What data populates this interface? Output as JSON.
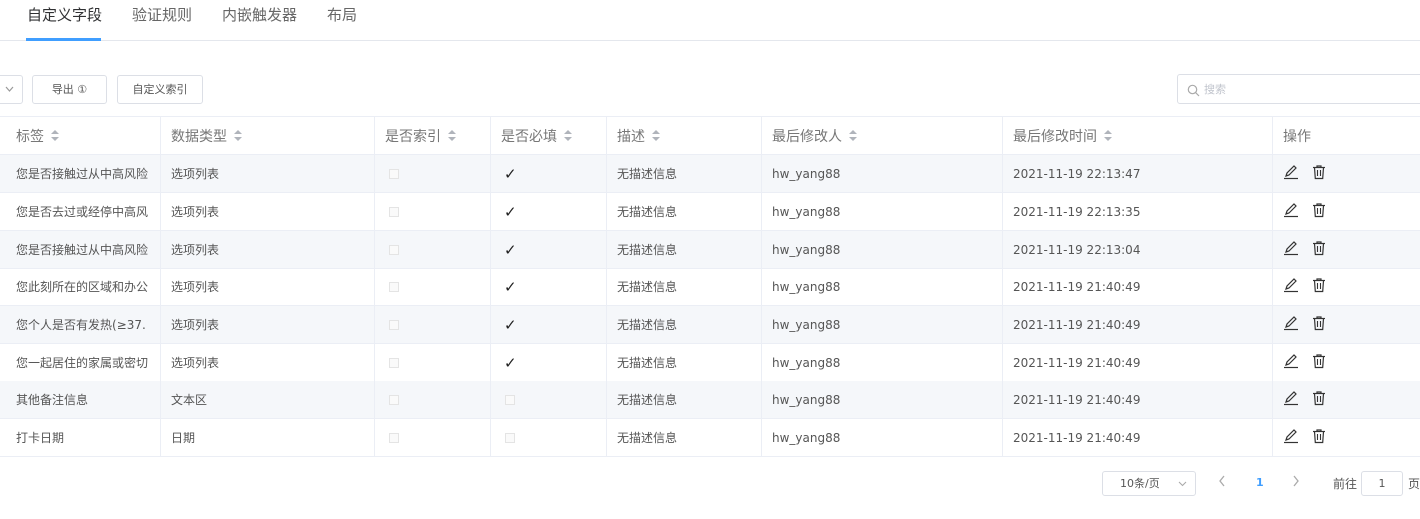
{
  "tabs": [
    {
      "label": "自定义字段",
      "active": true
    },
    {
      "label": "验证规则",
      "active": false
    },
    {
      "label": "内嵌触发器",
      "active": false
    },
    {
      "label": "布局",
      "active": false
    }
  ],
  "toolbar": {
    "export_label": "导出 ①",
    "custom_index_label": "自定义索引",
    "search_placeholder": "搜索",
    "search_value": ""
  },
  "table": {
    "columns": [
      "标签",
      "数据类型",
      "是否索引",
      "是否必填",
      "描述",
      "最后修改人",
      "最后修改时间",
      "操作"
    ],
    "rows": [
      {
        "label": "您是否接触过从中高风险",
        "type": "选项列表",
        "indexed": false,
        "required": true,
        "desc": "无描述信息",
        "modifier": "hw_yang88",
        "time": "2021-11-19 22:13:47"
      },
      {
        "label": "您是否去过或经停中高风",
        "type": "选项列表",
        "indexed": false,
        "required": true,
        "desc": "无描述信息",
        "modifier": "hw_yang88",
        "time": "2021-11-19 22:13:35"
      },
      {
        "label": "您是否接触过从中高风险",
        "type": "选项列表",
        "indexed": false,
        "required": true,
        "desc": "无描述信息",
        "modifier": "hw_yang88",
        "time": "2021-11-19 22:13:04"
      },
      {
        "label": "您此刻所在的区域和办公",
        "type": "选项列表",
        "indexed": false,
        "required": true,
        "desc": "无描述信息",
        "modifier": "hw_yang88",
        "time": "2021-11-19 21:40:49"
      },
      {
        "label": "您个人是否有发热(≥37.",
        "type": "选项列表",
        "indexed": false,
        "required": true,
        "desc": "无描述信息",
        "modifier": "hw_yang88",
        "time": "2021-11-19 21:40:49"
      },
      {
        "label": "您一起居住的家属或密切",
        "type": "选项列表",
        "indexed": false,
        "required": true,
        "desc": "无描述信息",
        "modifier": "hw_yang88",
        "time": "2021-11-19 21:40:49"
      },
      {
        "label": "其他备注信息",
        "type": "文本区",
        "indexed": false,
        "required": false,
        "desc": "无描述信息",
        "modifier": "hw_yang88",
        "time": "2021-11-19 21:40:49"
      },
      {
        "label": "打卡日期",
        "type": "日期",
        "indexed": false,
        "required": false,
        "desc": "无描述信息",
        "modifier": "hw_yang88",
        "time": "2021-11-19 21:40:49"
      }
    ]
  },
  "pagination": {
    "page_size": "10条/页",
    "current_page": "1",
    "goto_label": "前往",
    "goto_value": "1",
    "page_suffix": "页"
  },
  "colors": {
    "accent": "#409eff",
    "stripe": "#f5f7fa",
    "border": "#ebeef5"
  },
  "icons": [
    "chevron-down-icon",
    "search-icon",
    "sort-icon",
    "checkmark-icon",
    "edit-icon",
    "trash-icon",
    "chevron-left-icon",
    "chevron-right-icon"
  ]
}
